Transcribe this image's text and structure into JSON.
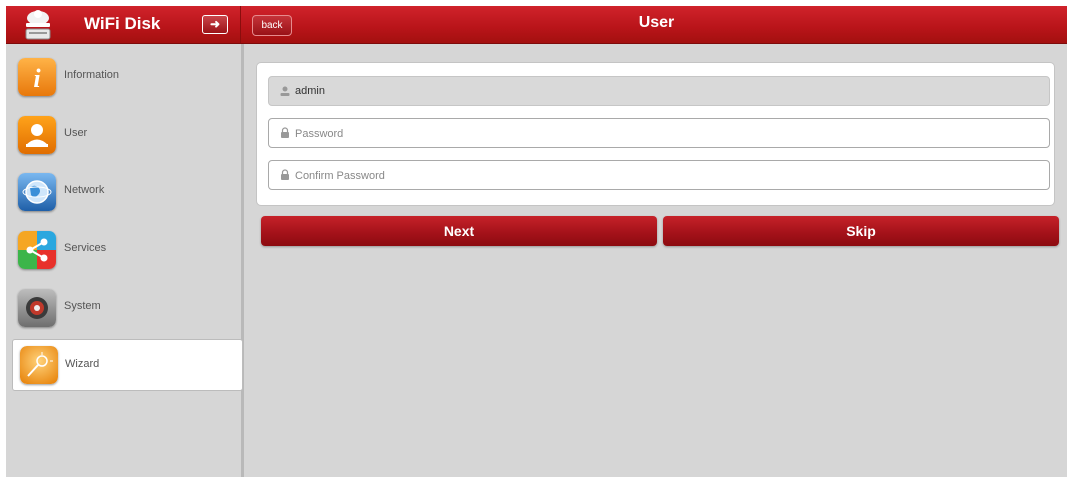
{
  "header": {
    "app_title": "WiFi Disk",
    "back_label": "back",
    "page_title": "User",
    "brand_color": "#b81419"
  },
  "sidebar": {
    "items": [
      {
        "label": "Information",
        "icon": "info-icon"
      },
      {
        "label": "User",
        "icon": "user-icon"
      },
      {
        "label": "Network",
        "icon": "globe-icon"
      },
      {
        "label": "Services",
        "icon": "share-icon"
      },
      {
        "label": "System",
        "icon": "gear-icon"
      },
      {
        "label": "Wizard",
        "icon": "wand-icon",
        "active": true
      }
    ]
  },
  "form": {
    "username_value": "admin",
    "password_placeholder": "Password",
    "confirm_placeholder": "Confirm Password"
  },
  "actions": {
    "next_label": "Next",
    "skip_label": "Skip"
  }
}
